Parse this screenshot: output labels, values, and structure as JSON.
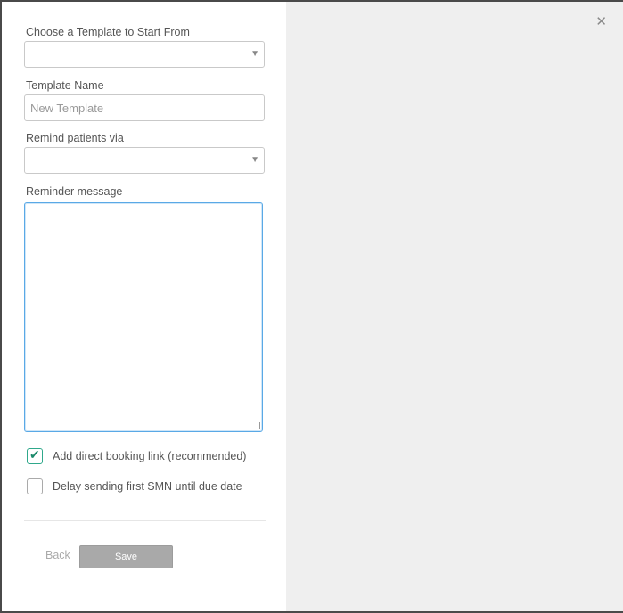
{
  "form": {
    "template_select_label": "Choose a Template to Start From",
    "template_select_value": "",
    "template_name_label": "Template Name",
    "template_name_placeholder": "New Template",
    "remind_via_label": "Remind patients via",
    "remind_via_value": "",
    "reminder_message_label": "Reminder message",
    "reminder_message_value": "",
    "booking_link": {
      "label": "Add direct booking link (recommended)",
      "checked": true
    },
    "delay_sending": {
      "label": "Delay sending first SMN until due date",
      "checked": false
    }
  },
  "actions": {
    "back_label": "Back",
    "save_label": "Save"
  },
  "icons": {
    "close": "close-icon",
    "caret": "chevron-down-icon",
    "check": "checkmark-icon"
  },
  "colors": {
    "accent_check": "#1c8a6b",
    "textarea_focus": "#5aa9e6",
    "save_button": "#a9a9a9",
    "right_pane": "#efefef"
  }
}
